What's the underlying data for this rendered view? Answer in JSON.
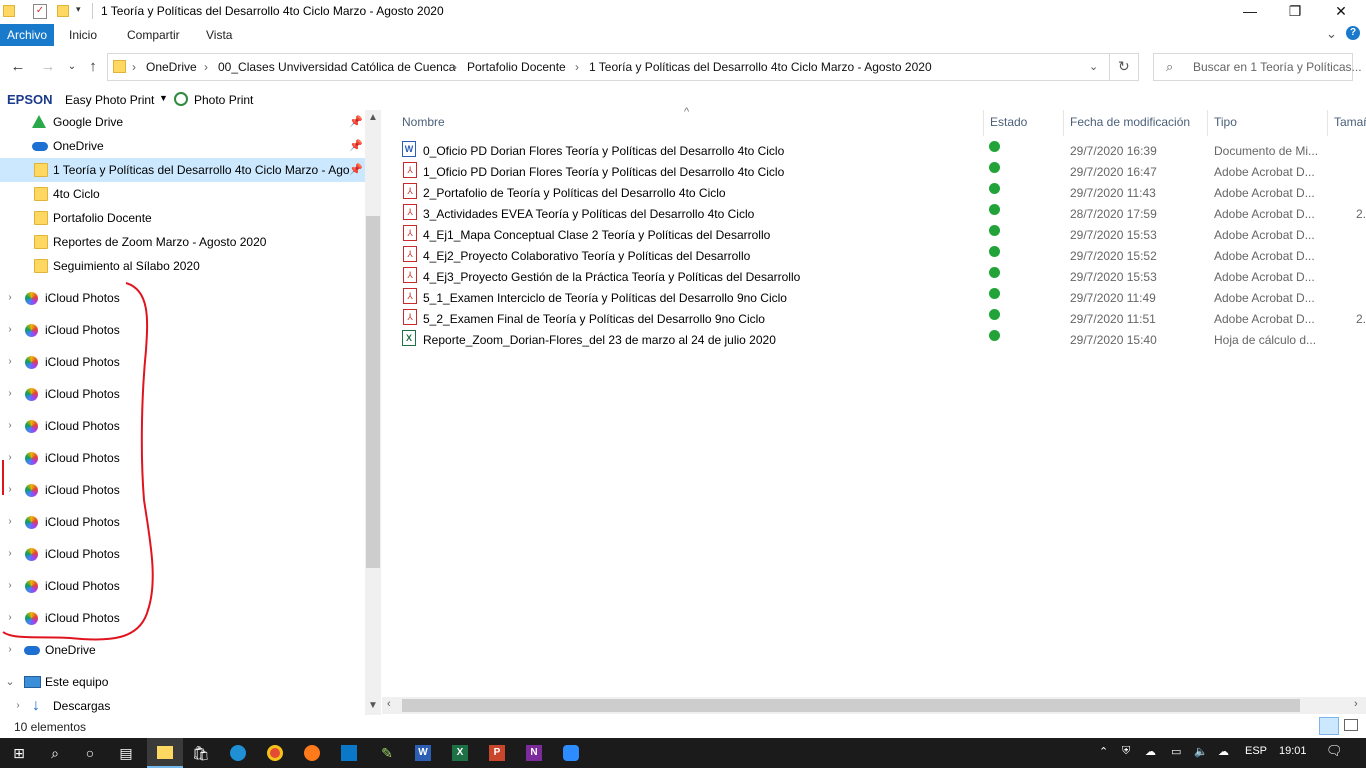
{
  "window": {
    "title": "1 Teoría y Políticas del Desarrollo 4to Ciclo Marzo - Agosto 2020",
    "minimize": "—",
    "maximize": "❐",
    "close": "✕"
  },
  "ribbon": {
    "tabs": [
      "Archivo",
      "Inicio",
      "Compartir",
      "Vista"
    ],
    "expand_glyph": "⌄",
    "help_glyph": "?"
  },
  "address": {
    "crumbs": [
      "OneDrive",
      "00_Clases Unviversidad Católica de Cuenca",
      "Portafolio Docente",
      "1 Teoría y Políticas del Desarrollo 4to Ciclo Marzo - Agosto 2020"
    ],
    "separator": "›",
    "search_placeholder": "Buscar en 1 Teoría y Políticas..."
  },
  "epson": {
    "brand": "EPSON",
    "easy_photo_print": "Easy Photo Print",
    "photo_print": "Photo Print"
  },
  "navpane": {
    "quick_access": [
      {
        "label": "Google Drive",
        "icon": "google-drive-icon",
        "pinned": true
      },
      {
        "label": "OneDrive",
        "icon": "onedrive-icon",
        "pinned": true
      },
      {
        "label": "1 Teoría y Políticas del Desarrollo 4to Ciclo Marzo - Agosto 2020",
        "icon": "folder-icon",
        "pinned": true,
        "selected": true
      },
      {
        "label": "4to Ciclo",
        "icon": "folder-icon"
      },
      {
        "label": "Portafolio Docente",
        "icon": "folder-icon"
      },
      {
        "label": "Reportes de Zoom Marzo - Agosto 2020",
        "icon": "folder-icon"
      },
      {
        "label": "Seguimiento al Sílabo 2020",
        "icon": "folder-icon"
      }
    ],
    "icloud_label": "iCloud Photos",
    "icloud_count": 11,
    "onedrive": "OneDrive",
    "this_pc": "Este equipo",
    "downloads": "Descargas"
  },
  "files": {
    "columns": {
      "name": "Nombre",
      "status": "Estado",
      "modified": "Fecha de modificación",
      "type": "Tipo",
      "size": "Tamañ"
    },
    "rows": [
      {
        "name": "0_Oficio PD Dorian Flores Teoría y Políticas del Desarrollo 4to Ciclo",
        "date": "29/7/2020 16:39",
        "type": "Documento de Mi...",
        "kind": "word",
        "size": ""
      },
      {
        "name": "1_Oficio PD Dorian Flores Teoría y Políticas del Desarrollo 4to Ciclo",
        "date": "29/7/2020 16:47",
        "type": "Adobe Acrobat D...",
        "kind": "pdf",
        "size": ""
      },
      {
        "name": "2_Portafolio de Teoría y Políticas del Desarrollo 4to Ciclo",
        "date": "29/7/2020 11:43",
        "type": "Adobe Acrobat D...",
        "kind": "pdf",
        "size": ""
      },
      {
        "name": "3_Actividades EVEA Teoría y Políticas del Desarrollo 4to Ciclo",
        "date": "28/7/2020 17:59",
        "type": "Adobe Acrobat D...",
        "kind": "pdf",
        "size": "2."
      },
      {
        "name": "4_Ej1_Mapa Conceptual Clase 2 Teoría y Políticas del Desarrollo",
        "date": "29/7/2020 15:53",
        "type": "Adobe Acrobat D...",
        "kind": "pdf",
        "size": ""
      },
      {
        "name": "4_Ej2_Proyecto Colaborativo Teoría y Políticas del Desarrollo",
        "date": "29/7/2020 15:52",
        "type": "Adobe Acrobat D...",
        "kind": "pdf",
        "size": ""
      },
      {
        "name": "4_Ej3_Proyecto Gestión de la Práctica Teoría y Políticas del Desarrollo",
        "date": "29/7/2020 15:53",
        "type": "Adobe Acrobat D...",
        "kind": "pdf",
        "size": ""
      },
      {
        "name": "5_1_Examen Interciclo de Teoría y Políticas del Desarrollo 9no Ciclo",
        "date": "29/7/2020 11:49",
        "type": "Adobe Acrobat D...",
        "kind": "pdf",
        "size": ""
      },
      {
        "name": "5_2_Examen Final de Teoría y Políticas del Desarrollo 9no Ciclo",
        "date": "29/7/2020 11:51",
        "type": "Adobe Acrobat D...",
        "kind": "pdf",
        "size": "2."
      },
      {
        "name": "Reporte_Zoom_Dorian-Flores_del 23 de marzo al 24 de julio 2020",
        "date": "29/7/2020 15:40",
        "type": "Hoja de cálculo d...",
        "kind": "excel",
        "size": ""
      }
    ]
  },
  "status": {
    "count": "10 elementos"
  },
  "taskbar": {
    "lang": "ESP",
    "time": "19:01"
  },
  "colors": {
    "accent": "#1979ca",
    "selected": "#cce8ff",
    "ok": "#22a33a",
    "annotation": "#e0141e"
  }
}
